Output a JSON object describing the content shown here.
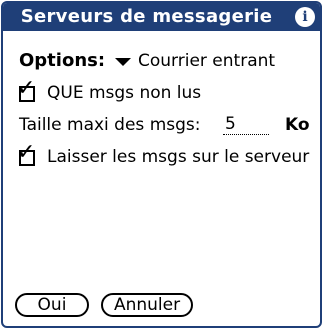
{
  "window": {
    "title": "Serveurs de messagerie",
    "info_icon": "info-icon",
    "info_glyph": "i"
  },
  "options": {
    "label": "Options:",
    "selected": "Courrier entrant"
  },
  "checkboxes": [
    {
      "label": "QUE msgs non lus",
      "checked": true
    },
    {
      "label": "Laisser les msgs sur le serveur",
      "checked": true
    }
  ],
  "max_size": {
    "label": "Taille maxi des msgs:",
    "value": "5",
    "unit": "Ko"
  },
  "buttons": {
    "ok": "Oui",
    "cancel": "Annuler"
  },
  "colors": {
    "title_bar": "#1f3f78",
    "background": "#ffffff"
  }
}
